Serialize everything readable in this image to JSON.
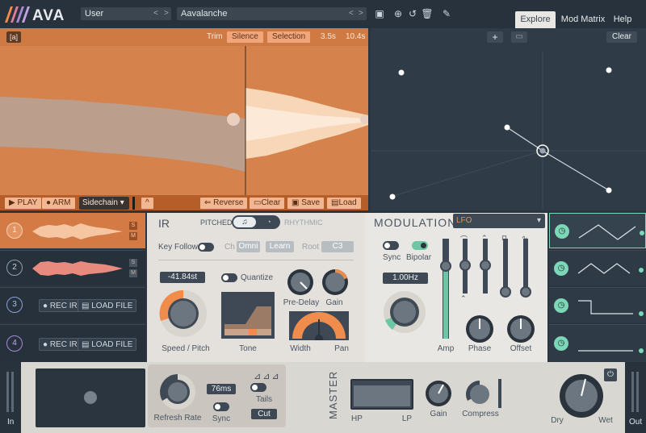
{
  "app": {
    "logo_text": "AVA"
  },
  "topbar": {
    "bank": "User",
    "preset": "Aavalanche",
    "tabs": [
      "Explore",
      "Mod Matrix",
      "Help"
    ]
  },
  "wave": {
    "zoom_label": "[a]",
    "trim_label": "Trim",
    "silence": "Silence",
    "selection": "Selection",
    "start_time": "3.5s",
    "end_time": "10.4s",
    "play": "PLAY",
    "arm": "ARM",
    "source": "Sidechain",
    "reverse": "Reverse",
    "clear": "Clear",
    "save": "Save",
    "load": "Load"
  },
  "xy": {
    "clear": "Clear"
  },
  "slots": [
    {
      "num": "1",
      "badge1": "S",
      "badge2": "M"
    },
    {
      "num": "2",
      "badge1": "S",
      "badge2": "M"
    },
    {
      "num": "3",
      "rec": "REC IR",
      "load": "LOAD FILE"
    },
    {
      "num": "4",
      "rec": "REC IR",
      "load": "LOAD FILE"
    }
  ],
  "ir": {
    "title": "IR",
    "pitched": "PITCHED",
    "rhythmic": "RHYTHMIC",
    "key_follow": "Key Follow",
    "ch_label": "Ch",
    "ch_value": "Omni",
    "learn": "Learn",
    "root_label": "Root",
    "root_value": "C3",
    "pitch_value": "-41.84st",
    "quantize": "Quantize",
    "speed_pitch": "Speed / Pitch",
    "tone": "Tone",
    "predelay": "Pre-Delay",
    "gain": "Gain",
    "width": "Width",
    "pan": "Pan"
  },
  "mod": {
    "title": "MODULATION",
    "source": "LFO",
    "sync": "Sync",
    "bipolar": "Bipolar",
    "rate": "1.00Hz",
    "amp": "Amp",
    "phase": "Phase",
    "offset": "Offset"
  },
  "bottom": {
    "in": "In",
    "out": "Out",
    "refresh_rate": "Refresh Rate",
    "time_value": "76ms",
    "sync": "Sync",
    "tails": "Tails",
    "cut": "Cut",
    "master": "MASTER",
    "hp": "HP",
    "lp": "LP",
    "gain": "Gain",
    "compress": "Compress",
    "dry": "Dry",
    "wet": "Wet"
  },
  "colors": {
    "accent": "#f08c4c",
    "mint": "#7cd6b8",
    "panel": "#2f3b46"
  }
}
